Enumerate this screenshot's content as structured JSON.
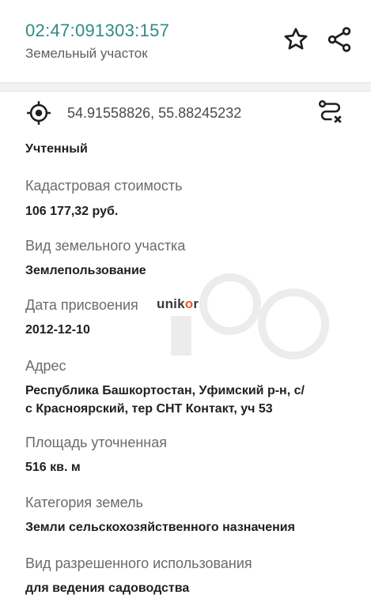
{
  "header": {
    "cadastral_number": "02:47:091303:157",
    "subtitle": "Земельный участок"
  },
  "coordinates": {
    "text": "54.91558826, 55.88245232"
  },
  "status": "Учтенный",
  "fields": [
    {
      "label": "Кадастровая стоимость",
      "value": "106 177,32 руб."
    },
    {
      "label": "Вид земельного участка",
      "value": "Землепользование"
    },
    {
      "label": "Дата присвоения",
      "value": "2012-12-10"
    },
    {
      "label": "Адрес",
      "value_line1": "Республика Башкортостан, Уфимский р-н, с/",
      "value_line2": "с Красноярский, тер СНТ Контакт, уч 53"
    },
    {
      "label": "Площадь уточненная",
      "value": "516 кв. м"
    },
    {
      "label": "Категория земель",
      "value": "Земли сельскохозяйственного назначения"
    },
    {
      "label": "Вид разрешенного использования",
      "value": "для ведения садоводства"
    }
  ],
  "watermark": {
    "prefix": "unik",
    "o": "o",
    "suffix": "r"
  },
  "colors": {
    "accent": "#2e8b84",
    "watermark_o": "#e85a2a"
  },
  "icons": [
    "star-icon",
    "share-icon",
    "location-target-icon",
    "route-icon"
  ]
}
